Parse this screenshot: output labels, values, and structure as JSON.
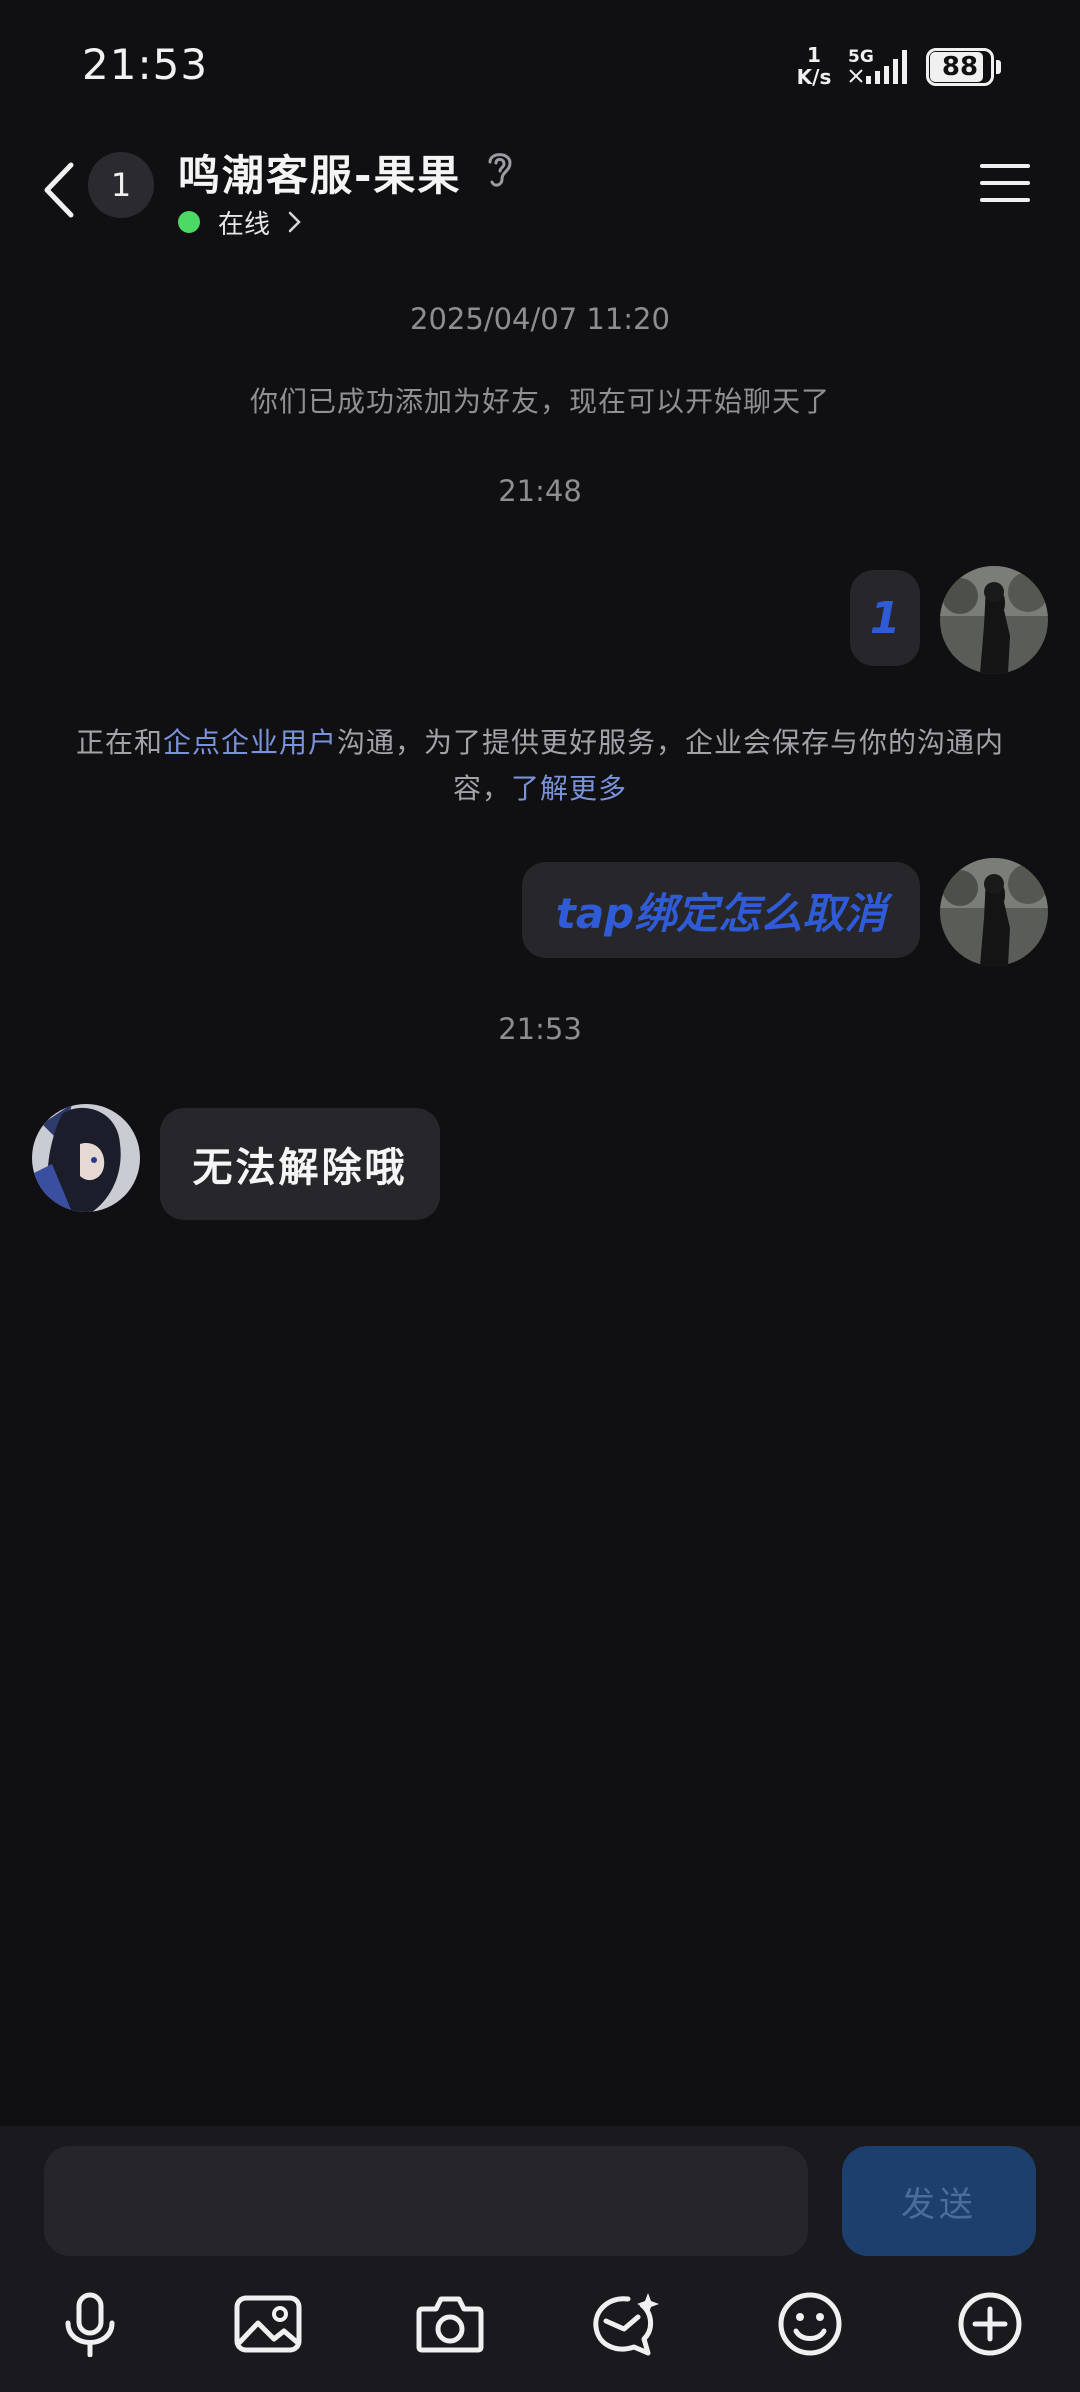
{
  "status_bar": {
    "time": "21:53",
    "net_speed_value": "1",
    "net_speed_unit": "K/s",
    "network": "5G",
    "battery": "88",
    "battery_level": 0.88
  },
  "header": {
    "unread_count": "1",
    "title": "鸣潮客服-果果",
    "status": "在线"
  },
  "messages": {
    "date_stamp": "2025/04/07 11:20",
    "friend_added": "你们已成功添加为好友，现在可以开始聊天了",
    "time_1": "21:48",
    "msg_1": "1",
    "enterprise_prefix": "正在和",
    "enterprise_name": "企点企业用户",
    "enterprise_middle": "沟通，为了提供更好服务，企业会保存与你的沟通内容，",
    "enterprise_link": "了解更多",
    "msg_2": "tap绑定怎么取消",
    "time_2": "21:53",
    "reply_1": "无法解除哦"
  },
  "input": {
    "value": "",
    "send_label": "发送"
  },
  "icons": {
    "voice": "microphone-icon",
    "image": "image-icon",
    "camera": "camera-icon",
    "sticker": "sticker-sparkle-icon",
    "emoji": "emoji-icon",
    "more": "plus-icon"
  },
  "colors": {
    "background": "#101013",
    "bubble": "#27272b",
    "accent_blue": "#2f5bd6",
    "link": "#7a92d9",
    "online": "#4cd964",
    "send_button": "#1d3f6e"
  }
}
